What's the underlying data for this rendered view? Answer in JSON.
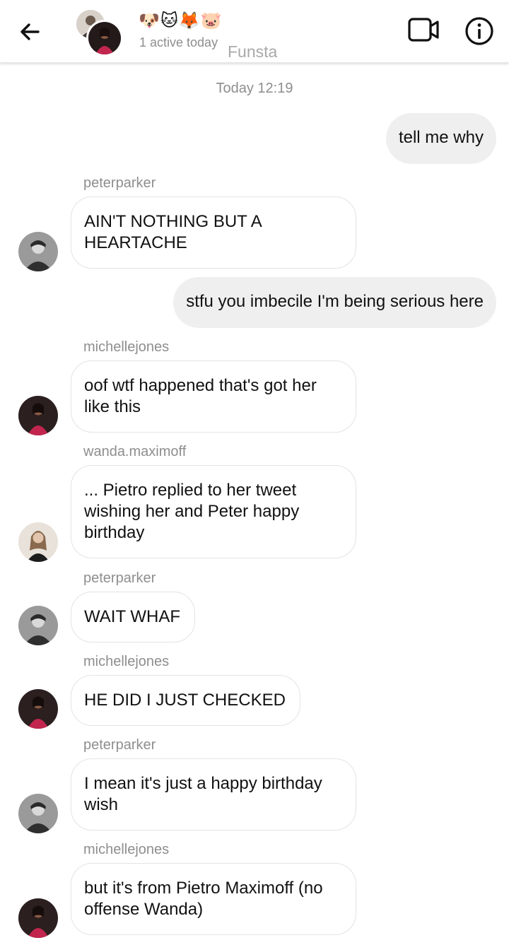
{
  "header": {
    "title": "🐶🐱🦊🐷",
    "status": "1 active today",
    "chat_name": "Funsta",
    "icons": {
      "back": "back-arrow-icon",
      "video": "video-call-icon",
      "info": "info-icon"
    }
  },
  "timestamp": "Today 12:19",
  "messages": [
    {
      "from": "me",
      "text": "tell me why"
    },
    {
      "from": "peterparker",
      "sender_label": "peterparker",
      "text": "AIN'T NOTHING BUT A HEARTACHE"
    },
    {
      "from": "me",
      "text": "stfu you imbecile I'm being serious here"
    },
    {
      "from": "michellejones",
      "sender_label": "michellejones",
      "text": "oof wtf happened that's got her like this"
    },
    {
      "from": "wanda.maximoff",
      "sender_label": "wanda.maximoff",
      "text": "... Pietro replied to her tweet wishing her and Peter happy birthday"
    },
    {
      "from": "peterparker",
      "sender_label": "peterparker",
      "text": "WAIT WHAF"
    },
    {
      "from": "michellejones",
      "sender_label": "michellejones",
      "text": "HE DID I JUST CHECKED"
    },
    {
      "from": "peterparker",
      "sender_label": "peterparker",
      "text": "I mean it's just a happy birthday wish"
    },
    {
      "from": "michellejones",
      "sender_label": "michellejones",
      "text": "but it's from Pietro Maximoff (no offense Wanda)"
    }
  ],
  "colors": {
    "outgoing_bubble": "#efefef",
    "incoming_border": "#e3e3e3",
    "muted_text": "#8e8e8e",
    "peter_avatar": "#3a3a3a",
    "michelle_avatar": "#2b1f1f",
    "michelle_outfit": "#c2264e",
    "wanda_avatar": "#e8e2da"
  }
}
